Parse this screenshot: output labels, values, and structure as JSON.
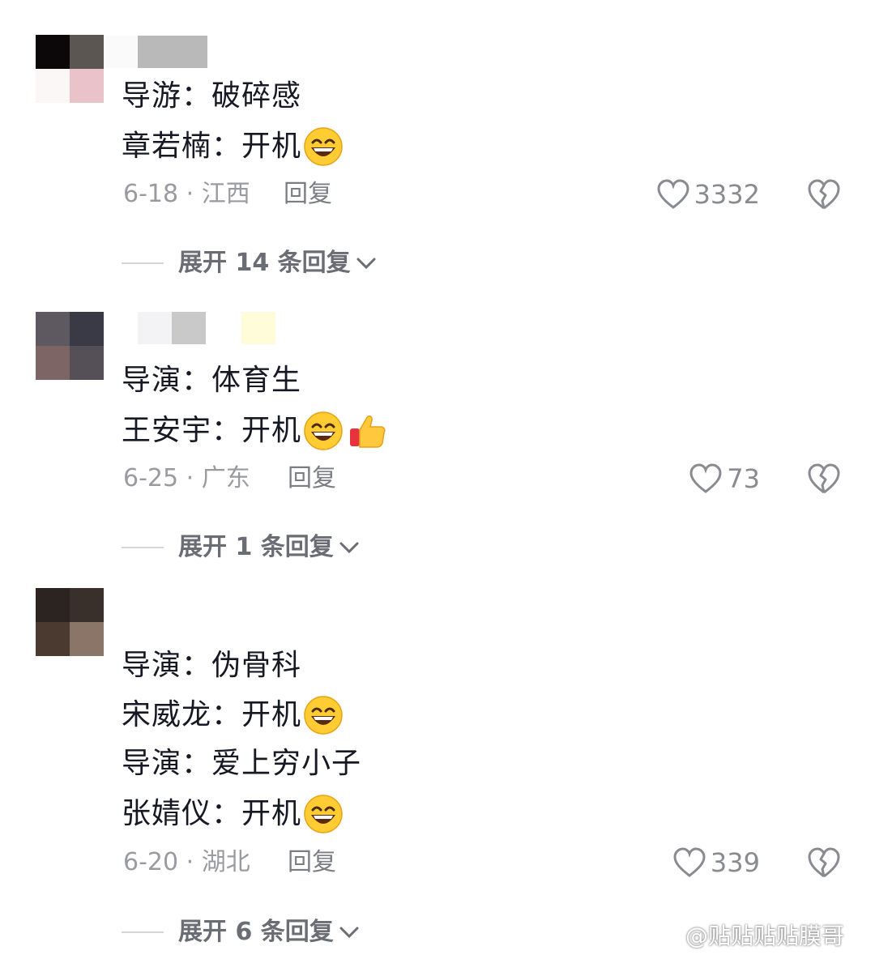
{
  "comments": [
    {
      "lines": [
        {
          "text": "导游：破碎感",
          "emoji": ""
        },
        {
          "text": "章若楠：开机",
          "emoji": "grin"
        }
      ],
      "date_location": "6-18 · 江西",
      "reply_label": "回复",
      "likes": "3332",
      "expand_label": "展开 14 条回复"
    },
    {
      "lines": [
        {
          "text": "导演：体育生",
          "emoji": ""
        },
        {
          "text": "王安宇：开机",
          "emoji": "grin+thumb"
        }
      ],
      "date_location": "6-25 · 广东",
      "reply_label": "回复",
      "likes": "73",
      "expand_label": "展开 1 条回复"
    },
    {
      "lines": [
        {
          "text": "导演：伪骨科",
          "emoji": ""
        },
        {
          "text": "宋威龙：开机",
          "emoji": "grin"
        },
        {
          "text": "导演：爱上穷小子",
          "emoji": ""
        },
        {
          "text": "张婧仪：开机",
          "emoji": "grin"
        }
      ],
      "date_location": "6-20 · 湖北",
      "reply_label": "回复",
      "likes": "339",
      "expand_label": "展开 6 条回复"
    }
  ],
  "watermark": "@贴贴贴贴膜哥",
  "icons": {
    "like": "heart-outline-icon",
    "dislike": "broken-heart-icon",
    "expand": "chevron-down-icon",
    "emoji_grin": "grinning-face-emoji",
    "emoji_thumb": "thumbs-up-emoji",
    "watermark_logo": "weibo-logo-icon"
  },
  "colors": {
    "text_primary": "#161823",
    "meta_gray": "#9a9ba1",
    "like_gray": "#8a8b91"
  }
}
